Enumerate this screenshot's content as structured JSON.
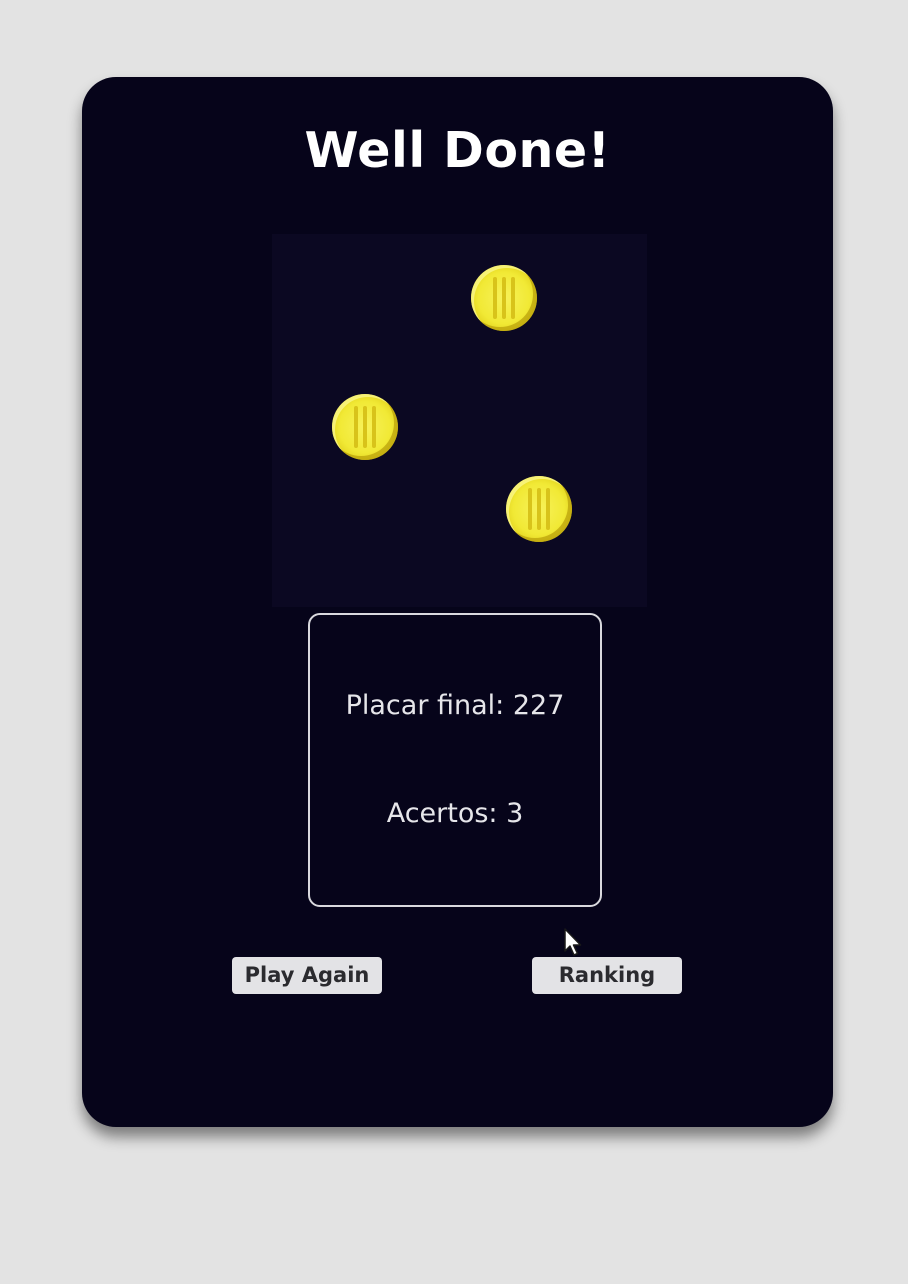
{
  "result": {
    "title": "Well Done!",
    "final_score_text": "Placar final: 227",
    "hits_text": "Acertos: 3"
  },
  "buttons": {
    "play_again": "Play Again",
    "ranking": "Ranking"
  },
  "stage": {
    "coins": 3,
    "coin_color": "#f1e935"
  },
  "colors": {
    "page_background": "#e3e3e3",
    "card_background": "#06041a",
    "stage_background": "#0b0822",
    "text": "#ffffff"
  },
  "icons": {
    "cursor": "mouse-pointer-icon",
    "coin": "coin-icon"
  }
}
